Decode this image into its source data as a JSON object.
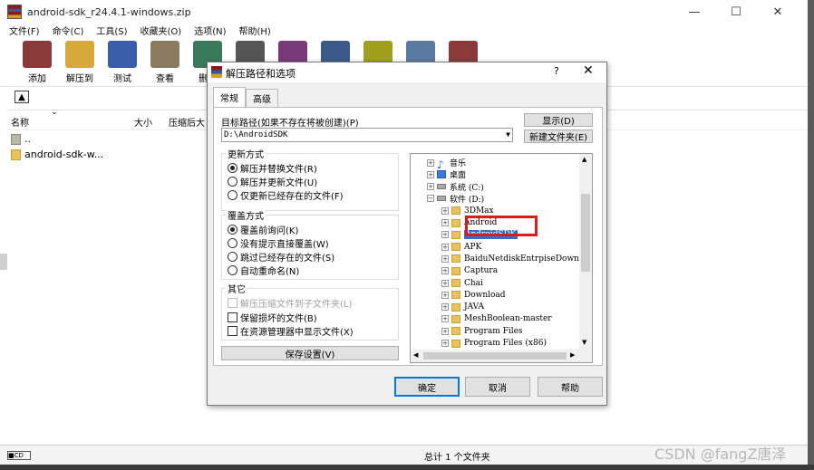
{
  "window": {
    "title": "android-sdk_r24.4.1-windows.zip",
    "controls": [
      "—",
      "☐",
      "✕"
    ]
  },
  "menu": [
    "文件(F)",
    "命令(C)",
    "工具(S)",
    "收藏夹(O)",
    "选项(N)",
    "帮助(H)"
  ],
  "toolbar": [
    {
      "label": "添加",
      "icon": "add-books-icon",
      "color": "#8b3a3a"
    },
    {
      "label": "解压到",
      "icon": "extract-folder-icon",
      "color": "#d7a93a"
    },
    {
      "label": "测试",
      "icon": "test-book-icon",
      "color": "#3a5fa8"
    },
    {
      "label": "查看",
      "icon": "view-glasses-icon",
      "color": "#8a7a60"
    },
    {
      "label": "删除",
      "icon": "delete-icon",
      "color": "#3a7a5a"
    },
    {
      "label": "",
      "icon": "find-binoculars-icon",
      "color": "#555555"
    },
    {
      "label": "",
      "icon": "wizard-icon",
      "color": "#7a3a7a"
    },
    {
      "label": "",
      "icon": "info-icon",
      "color": "#3a5a8a"
    },
    {
      "label": "",
      "icon": "virus-scan-icon",
      "color": "#a0a020"
    },
    {
      "label": "",
      "icon": "comment-icon",
      "color": "#5a7aa0"
    },
    {
      "label": "",
      "icon": "sfx-icon",
      "color": "#8b3a3a"
    }
  ],
  "filelist": {
    "headers": {
      "name": "名称",
      "size": "大小",
      "packed": "压缩后大"
    },
    "rows": [
      {
        "name": "..",
        "type": "parent"
      },
      {
        "name": "android-sdk-w...",
        "type": "folder"
      }
    ]
  },
  "status": {
    "left_icon": "■CD",
    "text": "总计 1 个文件夹"
  },
  "watermark": "CSDN @fangZ唐泽",
  "dialog": {
    "title": "解压路径和选项",
    "help": "?",
    "close": "✕",
    "tabs": [
      "常规",
      "高级"
    ],
    "target_label": "目标路径(如果不存在将被创建)(P)",
    "target_value": "D:\\AndroidSDK",
    "show_button": "显示(D)",
    "new_folder_button": "新建文件夹(E)",
    "update_mode": {
      "title": "更新方式",
      "options": [
        {
          "label": "解压并替换文件(R)",
          "checked": true
        },
        {
          "label": "解压并更新文件(U)",
          "checked": false
        },
        {
          "label": "仅更新已经存在的文件(F)",
          "checked": false
        }
      ]
    },
    "overwrite_mode": {
      "title": "覆盖方式",
      "options": [
        {
          "label": "覆盖前询问(K)",
          "checked": true
        },
        {
          "label": "没有提示直接覆盖(W)",
          "checked": false
        },
        {
          "label": "跳过已经存在的文件(S)",
          "checked": false
        },
        {
          "label": "自动重命名(N)",
          "checked": false
        }
      ]
    },
    "misc": {
      "title": "其它",
      "options": [
        {
          "label": "解压压缩文件到子文件夹(L)",
          "checked": false,
          "disabled": true
        },
        {
          "label": "保留损坏的文件(B)",
          "checked": false,
          "disabled": false
        },
        {
          "label": "在资源管理器中显示文件(X)",
          "checked": false,
          "disabled": false
        }
      ]
    },
    "save_button": "保存设置(V)",
    "tree": [
      {
        "label": "音乐",
        "level": 1,
        "icon": "music-icon"
      },
      {
        "label": "桌面",
        "level": 1,
        "icon": "desktop-icon"
      },
      {
        "label": "系统 (C:)",
        "level": 1,
        "icon": "drive-icon"
      },
      {
        "label": "软件 (D:)",
        "level": 1,
        "icon": "drive-icon",
        "expanded": true
      },
      {
        "label": "3DMax",
        "level": 2
      },
      {
        "label": "Android",
        "level": 2
      },
      {
        "label": "AndroidSDK",
        "level": 2,
        "selected": true
      },
      {
        "label": "APK",
        "level": 2
      },
      {
        "label": "BaiduNetdiskEntrpiseDown",
        "level": 2
      },
      {
        "label": "Captura",
        "level": 2
      },
      {
        "label": "Chai",
        "level": 2
      },
      {
        "label": "Download",
        "level": 2
      },
      {
        "label": "JAVA",
        "level": 2
      },
      {
        "label": "MeshBoolean-master",
        "level": 2
      },
      {
        "label": "Program Files",
        "level": 2
      },
      {
        "label": "Program Files (x86)",
        "level": 2
      }
    ],
    "ok": "确定",
    "cancel": "取消",
    "help_button": "帮助"
  }
}
